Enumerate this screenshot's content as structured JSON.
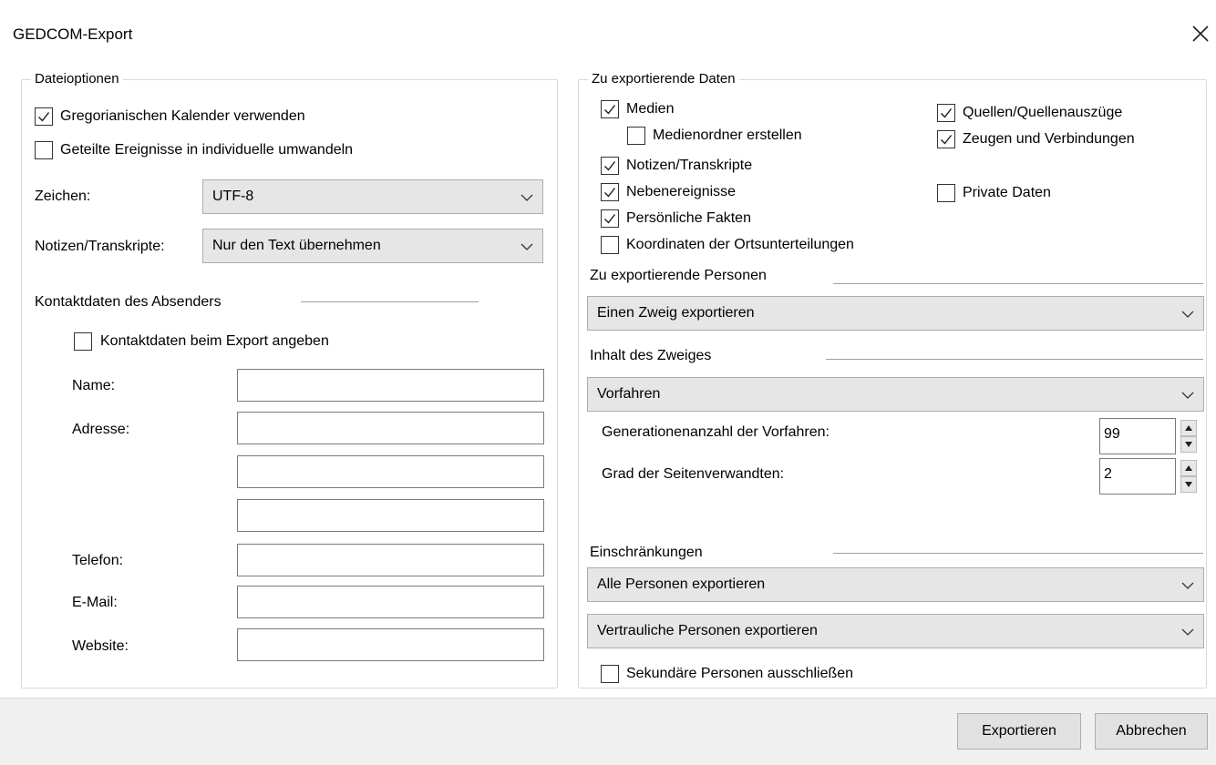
{
  "window": {
    "title": "GEDCOM-Export"
  },
  "file_options": {
    "legend": "Dateioptionen",
    "gregorian": {
      "label": "Gregorianischen Kalender verwenden",
      "checked": true
    },
    "split_events": {
      "label": "Geteilte Ereignisse in individuelle umwandeln",
      "checked": false
    },
    "charset": {
      "label": "Zeichen:",
      "value": "UTF-8"
    },
    "notes": {
      "label": "Notizen/Transkripte:",
      "value": "Nur den Text übernehmen"
    }
  },
  "sender": {
    "heading": "Kontaktdaten des Absenders",
    "include": {
      "label": "Kontaktdaten beim Export angeben",
      "checked": false
    },
    "name_label": "Name:",
    "address_label": "Adresse:",
    "phone_label": "Telefon:",
    "email_label": "E-Mail:",
    "website_label": "Website:",
    "name": "",
    "address1": "",
    "address2": "",
    "address3": "",
    "phone": "",
    "email": "",
    "website": ""
  },
  "export_data": {
    "legend": "Zu exportierende Daten",
    "media": {
      "label": "Medien",
      "checked": true
    },
    "media_folder": {
      "label": "Medienordner erstellen",
      "checked": false
    },
    "notes": {
      "label": "Notizen/Transkripte",
      "checked": true
    },
    "side_events": {
      "label": "Nebenereignisse",
      "checked": true
    },
    "personal_facts": {
      "label": "Persönliche Fakten",
      "checked": true
    },
    "coords": {
      "label": "Koordinaten der Ortsunterteilungen",
      "checked": false
    },
    "sources": {
      "label": "Quellen/Quellenauszüge",
      "checked": true
    },
    "witnesses": {
      "label": "Zeugen und Verbindungen",
      "checked": true
    },
    "private": {
      "label": "Private Daten",
      "checked": false
    }
  },
  "persons": {
    "heading": "Zu exportierende Personen",
    "selection": "Einen Zweig exportieren"
  },
  "branch": {
    "heading": "Inhalt des Zweiges",
    "selection": "Vorfahren",
    "generations_label": "Generationenanzahl der Vorfahren:",
    "generations": "99",
    "degree_label": "Grad der Seitenverwandten:",
    "degree": "2"
  },
  "restrictions": {
    "heading": "Einschränkungen",
    "all_persons": "Alle Personen exportieren",
    "confidential": "Vertrauliche Personen exportieren",
    "exclude_secondary": {
      "label": "Sekundäre Personen ausschließen",
      "checked": false
    }
  },
  "buttons": {
    "export": "Exportieren",
    "cancel": "Abbrechen"
  }
}
